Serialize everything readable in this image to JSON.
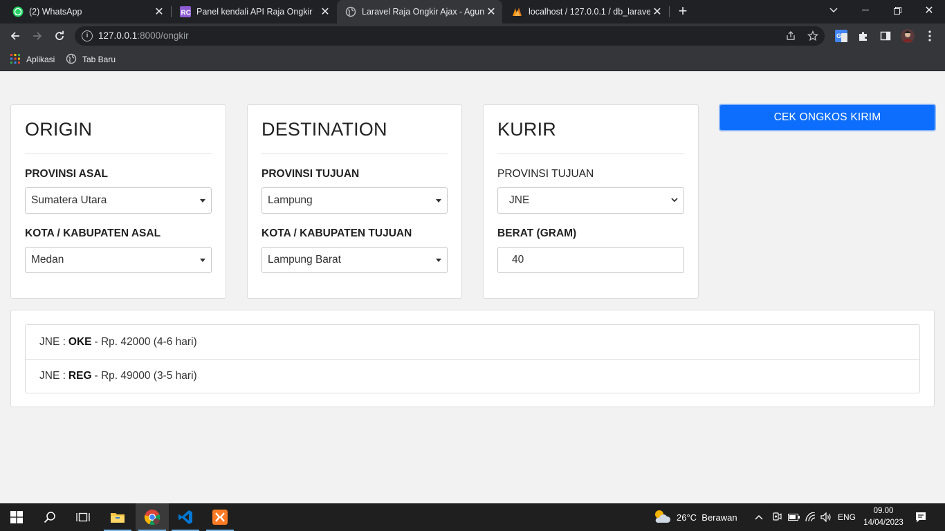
{
  "browser": {
    "tabs": [
      {
        "title": "(2) WhatsApp",
        "icon": "whatsapp-icon"
      },
      {
        "title": "Panel kendali API Raja Ongkir",
        "icon": "rajaongkir-icon"
      },
      {
        "title": "Laravel Raja Ongkir Ajax - Agung",
        "icon": "globe-icon"
      },
      {
        "title": "localhost / 127.0.0.1 / db_laravel_",
        "icon": "phpmyadmin-icon"
      }
    ],
    "url_host": "127.0.0.1",
    "url_path": ":8000/ongkir",
    "bookmarks": [
      {
        "label": "Aplikasi",
        "icon": "apps-grid-icon"
      },
      {
        "label": "Tab Baru",
        "icon": "globe-icon"
      }
    ]
  },
  "origin": {
    "title": "ORIGIN",
    "province_label": "PROVINSI ASAL",
    "province_value": "Sumatera Utara",
    "city_label": "KOTA / KABUPATEN ASAL",
    "city_value": "Medan"
  },
  "destination": {
    "title": "DESTINATION",
    "province_label": "PROVINSI TUJUAN",
    "province_value": "Lampung",
    "city_label": "KOTA / KABUPATEN TUJUAN",
    "city_value": "Lampung Barat"
  },
  "courier": {
    "title": "KURIR",
    "courier_label": "PROVINSI TUJUAN",
    "courier_value": "JNE",
    "weight_label": "BERAT (GRAM)",
    "weight_value": "40"
  },
  "check_button_label": "CEK ONGKOS KIRIM",
  "results": [
    {
      "courier": "JNE :",
      "service": "OKE",
      "detail": "- Rp. 42000 (4-6 hari)"
    },
    {
      "courier": "JNE :",
      "service": "REG",
      "detail": "- Rp. 49000 (3-5 hari)"
    }
  ],
  "taskbar": {
    "weather": "26°C  Berawan",
    "language": "ENG",
    "time": "09.00",
    "date": "14/04/2023"
  },
  "colors": {
    "accent": "#0d6efd",
    "page_bg": "#f2f2f2"
  }
}
